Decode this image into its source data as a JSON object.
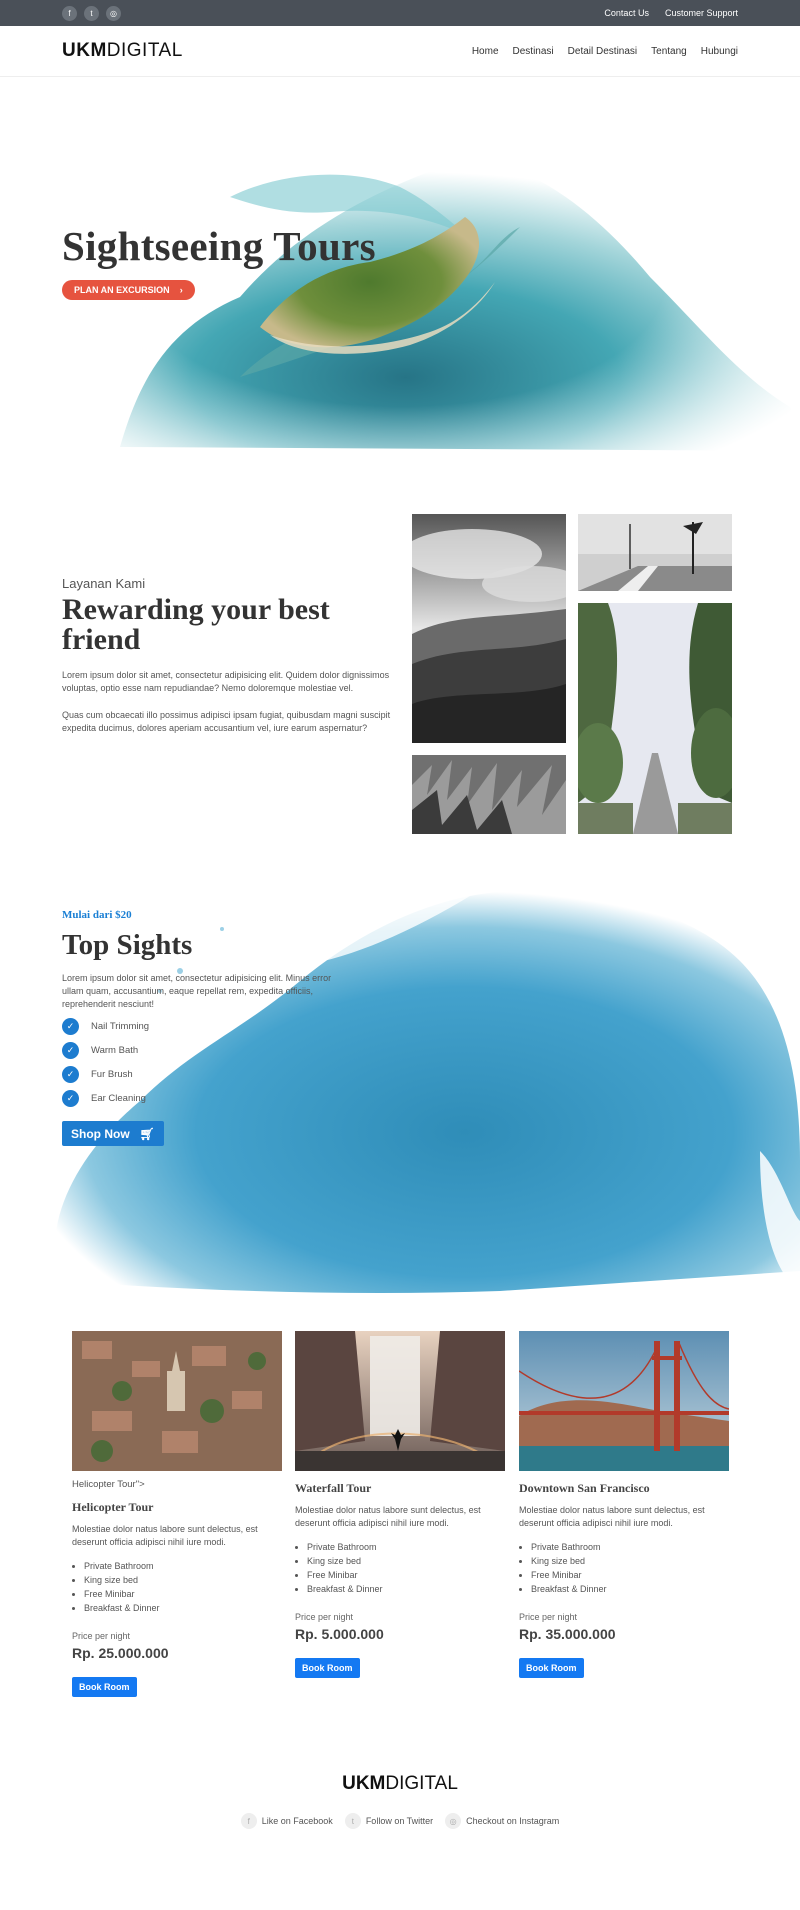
{
  "topbar": {
    "social": [
      {
        "icon": "facebook-icon",
        "glyph": "f"
      },
      {
        "icon": "twitter-icon",
        "glyph": "t"
      },
      {
        "icon": "instagram-icon",
        "glyph": "◎"
      }
    ],
    "links": [
      "Contact Us",
      "Customer Support"
    ]
  },
  "header": {
    "logo_bold": "UKM",
    "logo_light": "DIGITAL",
    "nav": [
      "Home",
      "Destinasi",
      "Detail Destinasi",
      "Tentang",
      "Hubungi"
    ]
  },
  "hero": {
    "title": "Sightseeing Tours",
    "button": "PLAN AN EXCURSION",
    "button_icon": "chevron-right-icon",
    "accent": "#e6533f"
  },
  "services": {
    "subtitle": "Layanan Kami",
    "title": "Rewarding your best friend",
    "paragraphs": [
      "Lorem ipsum dolor sit amet, consectetur adipisicing elit. Quidem dolor dignissimos voluptas, optio esse nam repudiandae? Nemo doloremque molestiae vel.",
      "Quas cum obcaecati illo possimus adipisci ipsam fugiat, quibusdam magni suscipit expedita ducimus, dolores aperiam accusantium vel, iure earum aspernatur?"
    ]
  },
  "sights": {
    "price_label": "Mulai dari $20",
    "title": "Top Sights",
    "description": "Lorem ipsum dolor sit amet, consectetur adipisicing elit. Minus error ullam quam, accusantium, eaque repellat rem, expedita officiis, reprehenderit nesciunt!",
    "features": [
      "Nail Trimming",
      "Warm Bath",
      "Fur Brush",
      "Ear Cleaning"
    ],
    "button": "Shop Now",
    "button_icon": "cart-icon",
    "accent": "#1d7ccf"
  },
  "rooms": [
    {
      "alt_text": "Helicopter Tour\">",
      "title": "Helicopter Tour",
      "description": "Molestiae dolor natus labore sunt delectus, est deserunt officia adipisci nihil iure modi.",
      "amenities": [
        "Private Bathroom",
        "King size bed",
        "Free Minibar",
        "Breakfast & Dinner"
      ],
      "price_label": "Price per night",
      "price": "Rp. 25.000.000",
      "button": "Book Room"
    },
    {
      "alt_text": "",
      "title": "Waterfall Tour",
      "description": "Molestiae dolor natus labore sunt delectus, est deserunt officia adipisci nihil iure modi.",
      "amenities": [
        "Private Bathroom",
        "King size bed",
        "Free Minibar",
        "Breakfast & Dinner"
      ],
      "price_label": "Price per night",
      "price": "Rp. 5.000.000",
      "button": "Book Room"
    },
    {
      "alt_text": "",
      "title": "Downtown San Francisco",
      "description": "Molestiae dolor natus labore sunt delectus, est deserunt officia adipisci nihil iure modi.",
      "amenities": [
        "Private Bathroom",
        "King size bed",
        "Free Minibar",
        "Breakfast & Dinner"
      ],
      "price_label": "Price per night",
      "price": "Rp. 35.000.000",
      "button": "Book Room"
    }
  ],
  "footer": {
    "logo_bold": "UKM",
    "logo_light": "DIGITAL",
    "links": [
      {
        "label": "Like on Facebook",
        "icon": "facebook-icon",
        "glyph": "f"
      },
      {
        "label": "Follow on Twitter",
        "icon": "twitter-icon",
        "glyph": "t"
      },
      {
        "label": "Checkout on Instagram",
        "icon": "instagram-icon",
        "glyph": "◎"
      }
    ]
  },
  "colors": {
    "topbar": "#4a5058",
    "button_blue": "#1479f2",
    "button_red": "#e6533f"
  }
}
